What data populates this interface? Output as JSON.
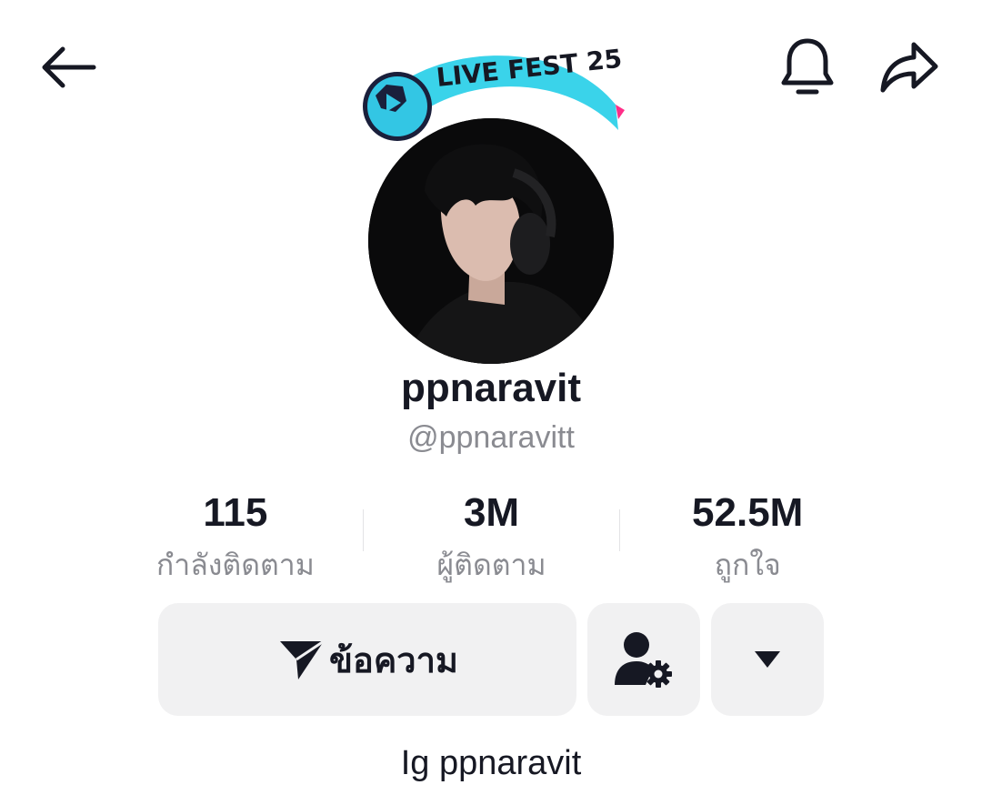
{
  "header": {
    "back_icon": "arrow-left-icon",
    "bell_icon": "bell-icon",
    "share_icon": "share-arrow-icon"
  },
  "badge": {
    "text": "LIVE FEST 25",
    "accent": "#35d4ee"
  },
  "profile": {
    "display_name": "ppnaravit",
    "handle": "@ppnaravitt",
    "bio": "Ig ppnaravit"
  },
  "stats": [
    {
      "value": "115",
      "label": "กำลังติดตาม"
    },
    {
      "value": "3M",
      "label": "ผู้ติดตาม"
    },
    {
      "value": "52.5M",
      "label": "ถูกใจ"
    }
  ],
  "actions": {
    "message_label": "ข้อความ",
    "message_icon": "send-icon",
    "friend_settings_icon": "person-gear-icon",
    "more_icon": "caret-down-icon"
  }
}
